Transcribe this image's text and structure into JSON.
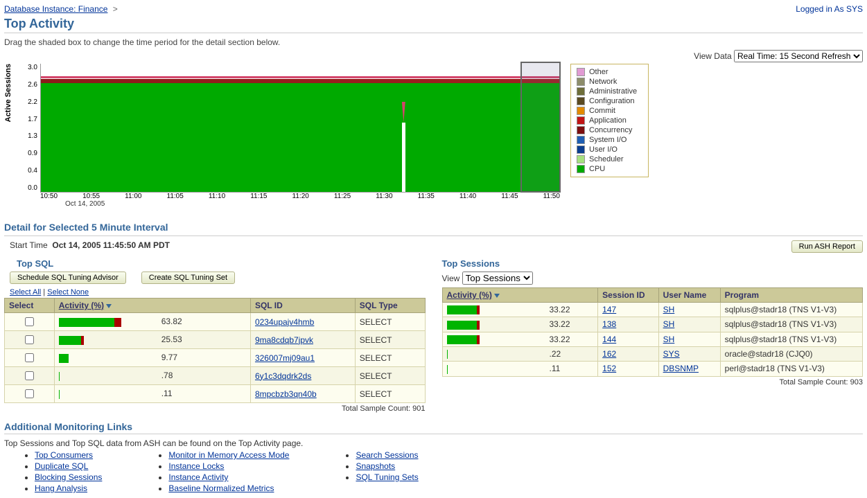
{
  "breadcrumb": {
    "link": "Database Instance: Finance",
    "sep": ">"
  },
  "logged_in_as": "Logged in As SYS",
  "page_title": "Top Activity",
  "instruction": "Drag the shaded box to change the time period for the detail section below.",
  "view_data_label": "View Data",
  "view_data_value": "Real Time: 15 Second Refresh",
  "chart_data": {
    "type": "area",
    "title": "Active Sessions",
    "ylabel": "Active Sessions",
    "ylim": [
      0.0,
      3.0
    ],
    "yticks": [
      "3.0",
      "2.6",
      "2.2",
      "1.7",
      "1.3",
      "0.9",
      "0.4",
      "0.0"
    ],
    "xticks": [
      "10:50",
      "10:55",
      "11:00",
      "11:05",
      "11:10",
      "11:15",
      "11:20",
      "11:25",
      "11:30",
      "11:35",
      "11:40",
      "11:45",
      "11:50"
    ],
    "xsub": "Oct 14, 2005",
    "legend": [
      {
        "name": "Other",
        "color": "#e19bd3"
      },
      {
        "name": "Network",
        "color": "#8d8d6b"
      },
      {
        "name": "Administrative",
        "color": "#6e6e3a"
      },
      {
        "name": "Configuration",
        "color": "#5a4a22"
      },
      {
        "name": "Commit",
        "color": "#e38b00"
      },
      {
        "name": "Application",
        "color": "#c21515"
      },
      {
        "name": "Concurrency",
        "color": "#7d0f0f"
      },
      {
        "name": "System I/O",
        "color": "#1f5fb3"
      },
      {
        "name": "User I/O",
        "color": "#0b3e8f"
      },
      {
        "name": "Scheduler",
        "color": "#a6e07f"
      },
      {
        "name": "CPU",
        "color": "#00aa00"
      }
    ],
    "baseline_value": 3.0,
    "series_note": "CPU steady ~2.9; thin Application/Concurrency ~0.05-0.1 on top; brief dip to ~1.5 near 11:32",
    "shaded_region": {
      "start": "11:45",
      "end": "11:50"
    }
  },
  "detail_header": "Detail for Selected 5 Minute Interval",
  "start_time_label": "Start Time",
  "start_time_value": "Oct 14, 2005 11:45:50 AM PDT",
  "run_ash_btn": "Run ASH Report",
  "top_sql": {
    "title": "Top SQL",
    "btn_schedule": "Schedule SQL Tuning Advisor",
    "btn_create_set": "Create SQL Tuning Set",
    "select_all": "Select All",
    "select_none": "Select None",
    "cols": {
      "select": "Select",
      "activity": "Activity (%)",
      "sqlid": "SQL ID",
      "sqltype": "SQL Type"
    },
    "rows": [
      {
        "pct": 63.82,
        "green": 56.84,
        "red": 6.98,
        "sqlid": "0234upajv4hmb",
        "type": "SELECT"
      },
      {
        "pct": 25.53,
        "green": 22.5,
        "red": 3.03,
        "sqlid": "9ma8cdqb7jpvk",
        "type": "SELECT"
      },
      {
        "pct": 9.77,
        "green": 9.77,
        "red": 0,
        "sqlid": "326007mj09au1",
        "type": "SELECT"
      },
      {
        "pct": 0.78,
        "green": 0.78,
        "red": 0,
        "sqlid": "6y1c3dqdrk2ds",
        "type": "SELECT"
      },
      {
        "pct": 0.11,
        "green": 0.11,
        "red": 0,
        "sqlid": "8mpcbzb3qn40b",
        "type": "SELECT"
      }
    ],
    "sample_count": "Total Sample Count: 901"
  },
  "top_sessions": {
    "title": "Top Sessions",
    "view_label": "View",
    "view_value": "Top Sessions",
    "cols": {
      "activity": "Activity (%)",
      "session": "Session ID",
      "user": "User Name",
      "program": "Program"
    },
    "rows": [
      {
        "pct": 33.22,
        "green": 30.56,
        "red": 2.66,
        "session": "147",
        "user": "SH",
        "program": "sqlplus@stadr18 (TNS V1-V3)"
      },
      {
        "pct": 33.22,
        "green": 30.56,
        "red": 2.66,
        "session": "138",
        "user": "SH",
        "program": "sqlplus@stadr18 (TNS V1-V3)"
      },
      {
        "pct": 33.22,
        "green": 30.56,
        "red": 2.66,
        "session": "144",
        "user": "SH",
        "program": "sqlplus@stadr18 (TNS V1-V3)"
      },
      {
        "pct": 0.22,
        "green": 0.22,
        "red": 0,
        "session": "162",
        "user": "SYS",
        "program": "oracle@stadr18 (CJQ0)"
      },
      {
        "pct": 0.11,
        "green": 0.11,
        "red": 0,
        "session": "152",
        "user": "DBSNMP",
        "program": "perl@stadr18 (TNS V1-V3)"
      }
    ],
    "sample_count": "Total Sample Count: 903"
  },
  "links_section": {
    "title": "Additional Monitoring Links",
    "note": "Top Sessions and Top SQL data from ASH can be found on the Top Activity page.",
    "col1": [
      "Top Consumers",
      "Duplicate SQL",
      "Blocking Sessions",
      "Hang Analysis"
    ],
    "col2": [
      "Monitor in Memory Access Mode",
      "Instance Locks",
      "Instance Activity",
      "Baseline Normalized Metrics"
    ],
    "col3": [
      "Search Sessions",
      "Snapshots",
      "SQL Tuning Sets"
    ]
  }
}
